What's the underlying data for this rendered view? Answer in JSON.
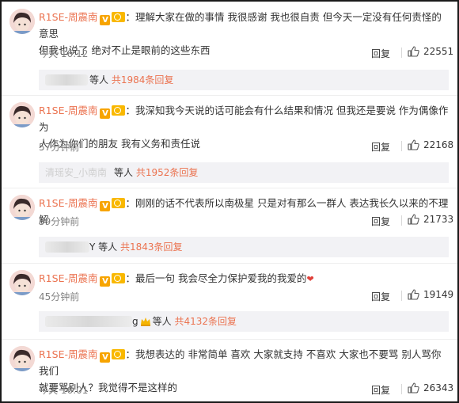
{
  "user_name": "R1SE-周震南",
  "reply_label": "回复",
  "comments": [
    {
      "text": "：理解大家在做的事情 我很感谢 我也很自责 但今天一定没有任何责怪的意思",
      "text2": "但我也说了 绝对不止是眼前的这些东西",
      "time": "今天 16:12",
      "likes": "22551",
      "sub_people": "等人",
      "sub_count": "共1984条回复"
    },
    {
      "text": "：我深知我今天说的话可能会有什么结果和情况 但我还是要说 作为偶像作为",
      "text2": "人作为你们的朋友 我有义务和责任说",
      "time": "57分钟前",
      "likes": "22168",
      "sub_blur": "清瑶安_小南南",
      "sub_people": "等人",
      "sub_count": "共1952条回复"
    },
    {
      "text": "：刚刚的话不代表所以南极星 只是对有那么一群人 表达我长久以来的不理解",
      "time": "59分钟前",
      "likes": "21733",
      "sub_blur_tail": "Y",
      "sub_people": "等人",
      "sub_count": "共1843条回复"
    },
    {
      "text": "：最后一句 我会尽全力保护爱我的我爱的",
      "time": "45分钟前",
      "likes": "19149",
      "sub_blur_tail": "g",
      "sub_people": "等人",
      "sub_count": "共4132条回复"
    },
    {
      "text": "：我想表达的 非常简单 喜欢 大家就支持 不喜欢 大家也不要骂 别人骂你我们",
      "text2": "就要骂别人？我觉得不是这样的",
      "time": "今天 16:01",
      "likes": "26343"
    }
  ],
  "colors": {
    "username": "#eb7350",
    "link": "#eb7350",
    "badge": "#f7a400"
  },
  "icons": {
    "like": "thumb-up-icon",
    "verified": "verified-v-icon",
    "crown": "crown-icon"
  }
}
